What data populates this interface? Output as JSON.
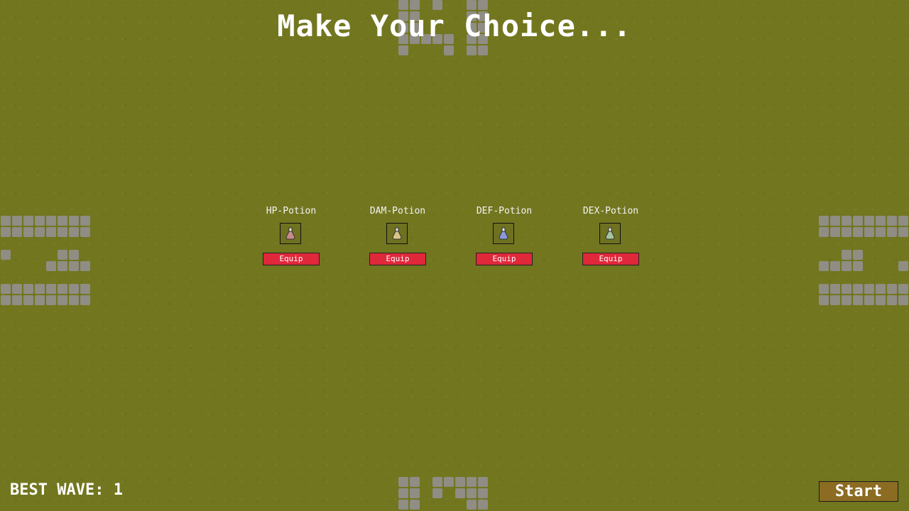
{
  "title": "Make Your Choice...",
  "choices": [
    {
      "name": "HP-Potion",
      "equip_label": "Equip",
      "icon": "red-potion-icon",
      "potion_color": "#c98a8a"
    },
    {
      "name": "DAM-Potion",
      "equip_label": "Equip",
      "icon": "tan-potion-icon",
      "potion_color": "#d8c48a"
    },
    {
      "name": "DEF-Potion",
      "equip_label": "Equip",
      "icon": "blue-potion-icon",
      "potion_color": "#8a9ad8"
    },
    {
      "name": "DEX-Potion",
      "equip_label": "Equip",
      "icon": "green-potion-icon",
      "potion_color": "#a6c4a0"
    }
  ],
  "best_wave": "BEST WAVE: 1",
  "start_label": "Start",
  "colors": {
    "background": "#72761f",
    "equip_button": "#e0283b",
    "start_button": "#8c6b22",
    "stone": "#8f8d84"
  }
}
